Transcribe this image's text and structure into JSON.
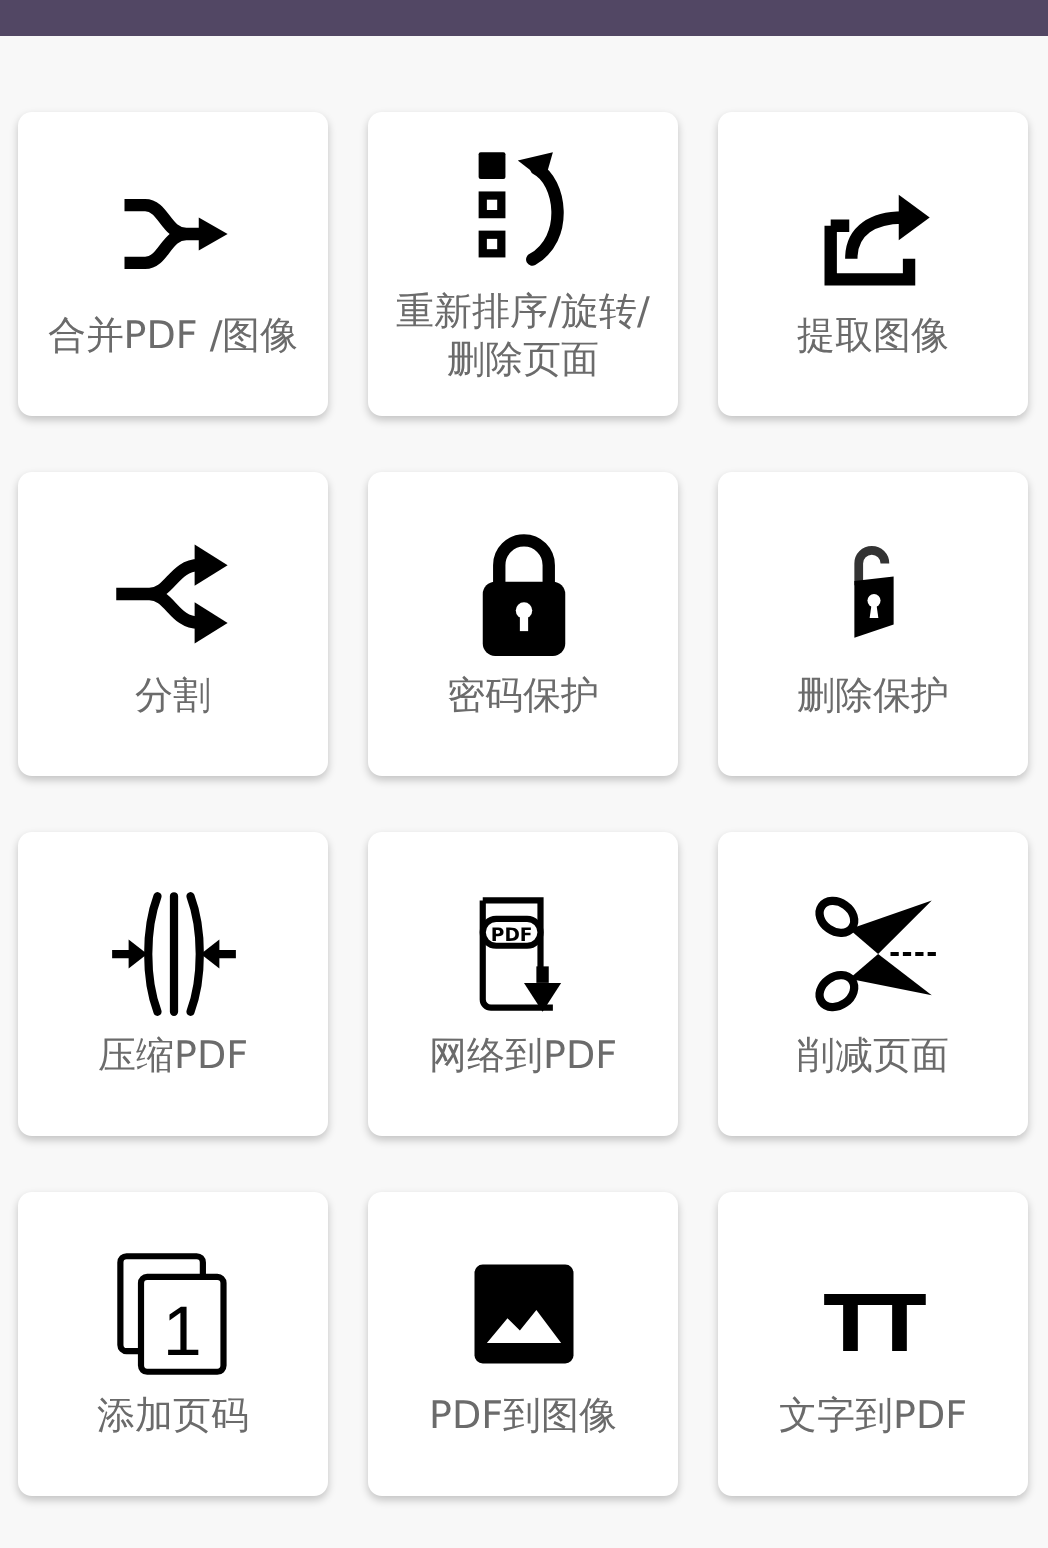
{
  "tools": [
    {
      "label": "合并PDF /图像",
      "kind": "merge"
    },
    {
      "label": "重新排序/旋转/删除页面",
      "kind": "reorder"
    },
    {
      "label": "提取图像",
      "kind": "extract"
    },
    {
      "label": "分割",
      "kind": "split"
    },
    {
      "label": "密码保护",
      "kind": "lock"
    },
    {
      "label": "删除保护",
      "kind": "unlock"
    },
    {
      "label": "压缩PDF",
      "kind": "compress"
    },
    {
      "label": "网络到PDF",
      "kind": "download",
      "icon_text": "PDF"
    },
    {
      "label": "削减页面",
      "kind": "cut"
    },
    {
      "label": "添加页码",
      "kind": "numbering",
      "icon_text": "1"
    },
    {
      "label": "PDF到图像",
      "kind": "image"
    },
    {
      "label": "文字到PDF",
      "kind": "text",
      "icon_text": "TT"
    }
  ]
}
